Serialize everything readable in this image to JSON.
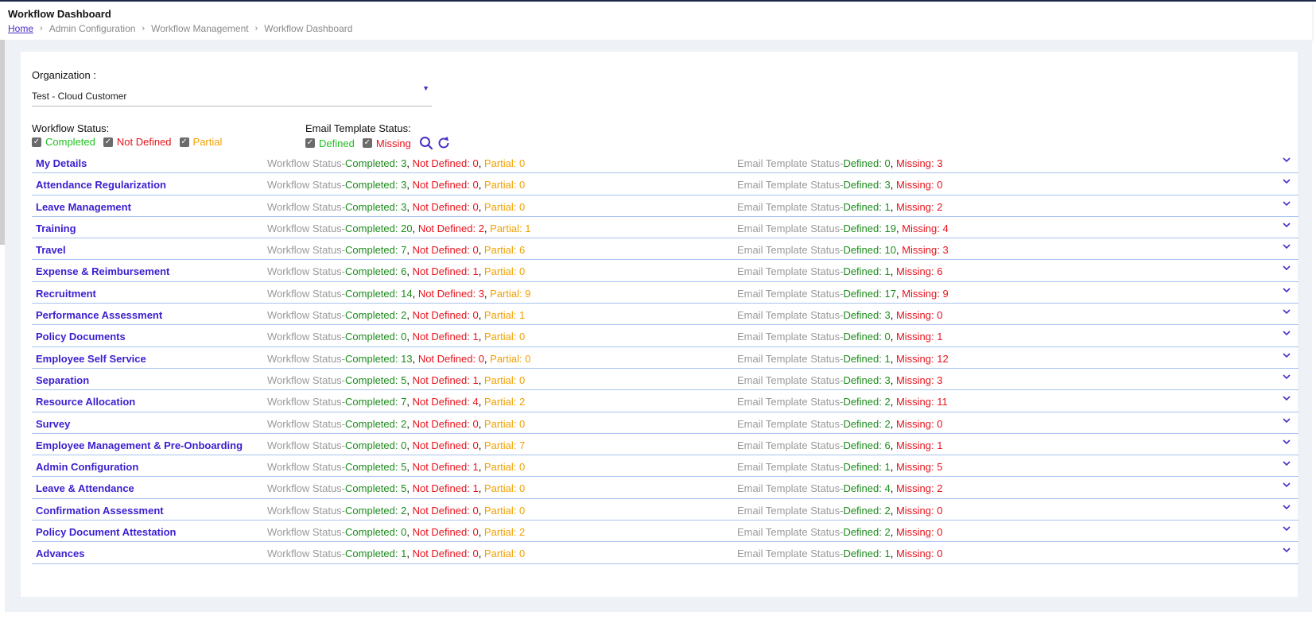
{
  "header": {
    "title": "Workflow Dashboard",
    "breadcrumb": [
      "Home",
      "Admin Configuration",
      "Workflow Management",
      "Workflow Dashboard"
    ]
  },
  "filters": {
    "organization_label": "Organization :",
    "organization_value": "Test - Cloud Customer",
    "workflow_status_label": "Workflow Status:",
    "workflow_options": [
      "Completed",
      "Not Defined",
      "Partial"
    ],
    "email_status_label": "Email Template Status:",
    "email_options": [
      "Defined",
      "Missing"
    ]
  },
  "labels": {
    "wf_prefix": "Workflow Status-",
    "et_prefix": "Email Template Status-",
    "completed": "Completed: ",
    "not_defined": "Not Defined: ",
    "partial": "Partial: ",
    "defined": "Defined: ",
    "missing": "Missing: "
  },
  "modules": [
    {
      "name": "My Details",
      "completed": 3,
      "not_defined": 0,
      "partial": 0,
      "defined": 0,
      "missing": 3
    },
    {
      "name": "Attendance Regularization",
      "completed": 3,
      "not_defined": 0,
      "partial": 0,
      "defined": 3,
      "missing": 0
    },
    {
      "name": "Leave Management",
      "completed": 3,
      "not_defined": 0,
      "partial": 0,
      "defined": 1,
      "missing": 2
    },
    {
      "name": "Training",
      "completed": 20,
      "not_defined": 2,
      "partial": 1,
      "defined": 19,
      "missing": 4
    },
    {
      "name": "Travel",
      "completed": 7,
      "not_defined": 0,
      "partial": 6,
      "defined": 10,
      "missing": 3
    },
    {
      "name": "Expense & Reimbursement",
      "completed": 6,
      "not_defined": 1,
      "partial": 0,
      "defined": 1,
      "missing": 6
    },
    {
      "name": "Recruitment",
      "completed": 14,
      "not_defined": 3,
      "partial": 9,
      "defined": 17,
      "missing": 9
    },
    {
      "name": "Performance Assessment",
      "completed": 2,
      "not_defined": 0,
      "partial": 1,
      "defined": 3,
      "missing": 0
    },
    {
      "name": "Policy Documents",
      "completed": 0,
      "not_defined": 1,
      "partial": 0,
      "defined": 0,
      "missing": 1
    },
    {
      "name": "Employee Self Service",
      "completed": 13,
      "not_defined": 0,
      "partial": 0,
      "defined": 1,
      "missing": 12
    },
    {
      "name": "Separation",
      "completed": 5,
      "not_defined": 1,
      "partial": 0,
      "defined": 3,
      "missing": 3
    },
    {
      "name": "Resource Allocation",
      "completed": 7,
      "not_defined": 4,
      "partial": 2,
      "defined": 2,
      "missing": 11
    },
    {
      "name": "Survey",
      "completed": 2,
      "not_defined": 0,
      "partial": 0,
      "defined": 2,
      "missing": 0
    },
    {
      "name": "Employee Management & Pre-Onboarding",
      "completed": 0,
      "not_defined": 0,
      "partial": 7,
      "defined": 6,
      "missing": 1
    },
    {
      "name": "Admin Configuration",
      "completed": 5,
      "not_defined": 1,
      "partial": 0,
      "defined": 1,
      "missing": 5
    },
    {
      "name": "Leave & Attendance",
      "completed": 5,
      "not_defined": 1,
      "partial": 0,
      "defined": 4,
      "missing": 2
    },
    {
      "name": "Confirmation Assessment",
      "completed": 2,
      "not_defined": 0,
      "partial": 0,
      "defined": 2,
      "missing": 0
    },
    {
      "name": "Policy Document Attestation",
      "completed": 0,
      "not_defined": 0,
      "partial": 2,
      "defined": 2,
      "missing": 0
    },
    {
      "name": "Advances",
      "completed": 1,
      "not_defined": 0,
      "partial": 0,
      "defined": 1,
      "missing": 0
    }
  ],
  "colors": {
    "accent": "#3a1fd0",
    "green": "#1ec21e",
    "red": "#e8121c",
    "orange": "#f0a000"
  }
}
